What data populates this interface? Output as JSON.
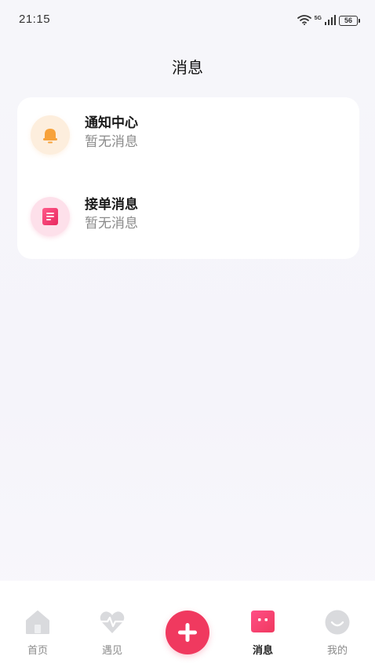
{
  "status_bar": {
    "time": "21:15",
    "network": "5G",
    "battery": "56"
  },
  "header": {
    "title": "消息"
  },
  "messages": [
    {
      "title": "通知中心",
      "subtitle": "暂无消息",
      "icon": "bell-icon",
      "color": "#f7a23b"
    },
    {
      "title": "接单消息",
      "subtitle": "暂无消息",
      "icon": "document-icon",
      "color": "#f0396a"
    }
  ],
  "tabs": [
    {
      "label": "首页",
      "icon": "home-icon",
      "active": false
    },
    {
      "label": "遇见",
      "icon": "heartbeat-icon",
      "active": false
    },
    {
      "label": "",
      "icon": "plus-icon",
      "active": false
    },
    {
      "label": "消息",
      "icon": "message-icon",
      "active": true
    },
    {
      "label": "我的",
      "icon": "smiley-icon",
      "active": false
    }
  ],
  "colors": {
    "accent": "#f0395f",
    "bell": "#f7a23b",
    "inactive_icon": "#d9dadd"
  }
}
